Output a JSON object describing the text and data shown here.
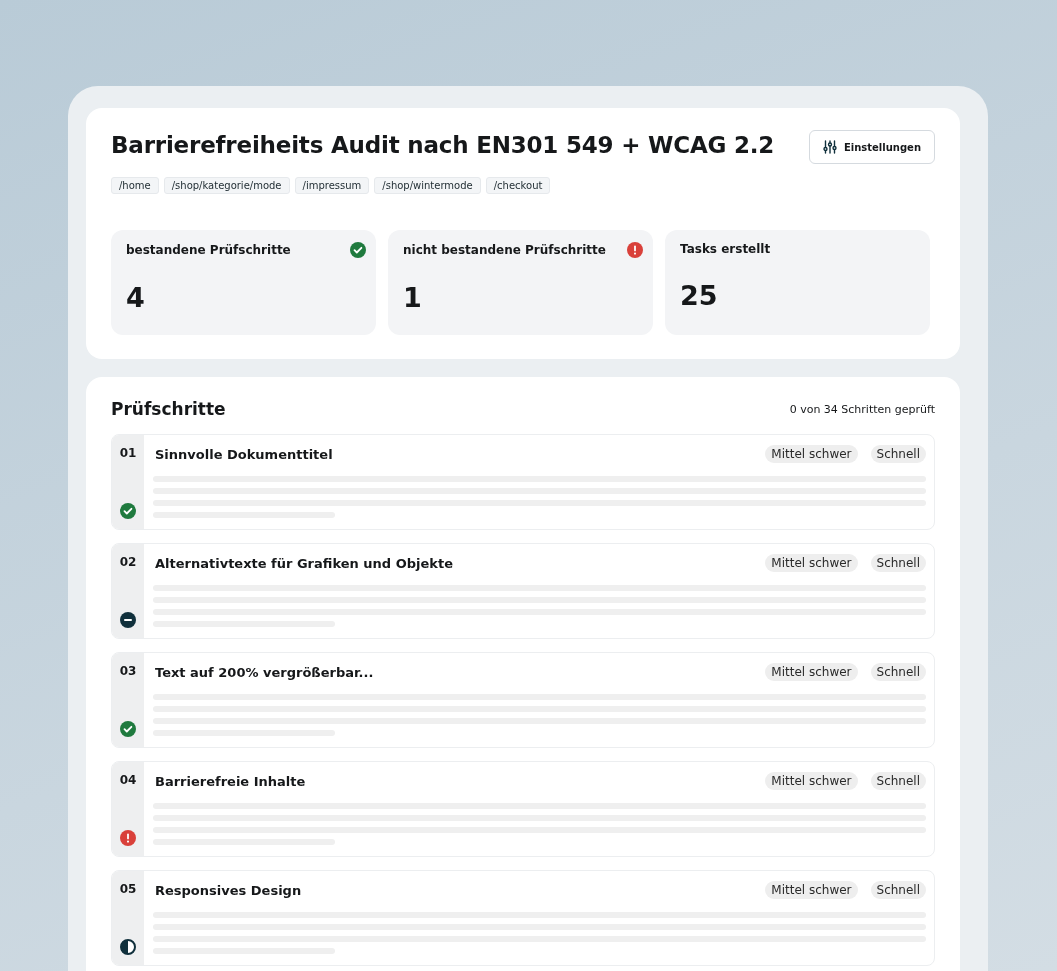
{
  "header": {
    "title": "Barrierefreiheits Audit nach EN301 549 + WCAG 2.2",
    "settings_button": "Einstellungen",
    "pages": [
      "/home",
      "/shop/kategorie/mode",
      "/impressum",
      "/shop/wintermode",
      "/checkout"
    ]
  },
  "stats": [
    {
      "label": "bestandene Prüfschritte",
      "value": "4",
      "kind": "passed"
    },
    {
      "label": "nicht bestandene Prüfschritte",
      "value": "1",
      "kind": "failed"
    },
    {
      "label": "Tasks erstellt",
      "value": "25",
      "kind": "none"
    }
  ],
  "steps_section": {
    "title": "Prüfschritte",
    "progress": "0 von 34 Schritten geprüft",
    "steps": [
      {
        "number": "01",
        "title": "Sinnvolle Dokumenttitel",
        "tags": [
          "Mittel schwer",
          "Schnell"
        ],
        "kind": "passed"
      },
      {
        "number": "02",
        "title": "Alternativtexte für Grafiken und Objekte",
        "tags": [
          "Mittel schwer",
          "Schnell"
        ],
        "kind": "not_applicable"
      },
      {
        "number": "03",
        "title": "Text auf 200% vergrößerbar...",
        "tags": [
          "Mittel schwer",
          "Schnell"
        ],
        "kind": "passed"
      },
      {
        "number": "04",
        "title": "Barrierefreie Inhalte",
        "tags": [
          "Mittel schwer",
          "Schnell"
        ],
        "kind": "failed"
      },
      {
        "number": "05",
        "title": "Responsives Design",
        "tags": [
          "Mittel schwer",
          "Schnell"
        ],
        "kind": "partial"
      }
    ]
  }
}
